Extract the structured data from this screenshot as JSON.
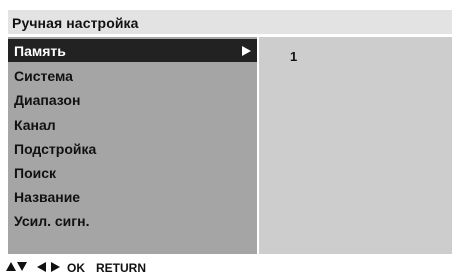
{
  "title": "Ручная настройка",
  "menu": {
    "items": [
      {
        "label": "Память",
        "selected": true
      },
      {
        "label": "Система"
      },
      {
        "label": "Диапазон"
      },
      {
        "label": "Канал"
      },
      {
        "label": "Подстройка"
      },
      {
        "label": "Поиск"
      },
      {
        "label": "Название"
      },
      {
        "label": "Усил. сигн."
      }
    ]
  },
  "value_panel": {
    "value": "1"
  },
  "footer": {
    "nav_icons": [
      "arrow-up-icon",
      "arrow-down-icon",
      "arrow-left-icon",
      "arrow-right-icon"
    ],
    "ok_label": "OK",
    "return_label": "RETURN"
  },
  "colors": {
    "title_bg": "#e3e3e3",
    "menu_bg": "#a5a5a5",
    "value_bg": "#cdcdcd",
    "selected_bg": "#222222",
    "selected_text": "#ffffff"
  }
}
